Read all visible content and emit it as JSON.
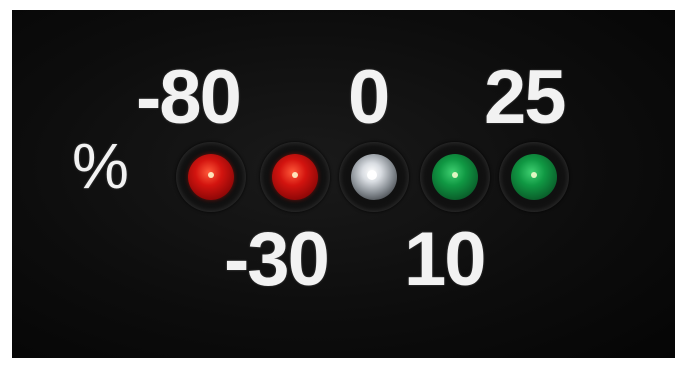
{
  "scale": {
    "unit": "%",
    "top_values": [
      "-80",
      "0",
      "25"
    ],
    "bottom_values": [
      "-30",
      "10"
    ]
  },
  "leds": [
    {
      "color": "red",
      "hex": "#d3140f"
    },
    {
      "color": "red",
      "hex": "#d3140f"
    },
    {
      "color": "clear-white",
      "hex": "#d9dde2"
    },
    {
      "color": "green",
      "hex": "#109843"
    },
    {
      "color": "green",
      "hex": "#109843"
    }
  ]
}
